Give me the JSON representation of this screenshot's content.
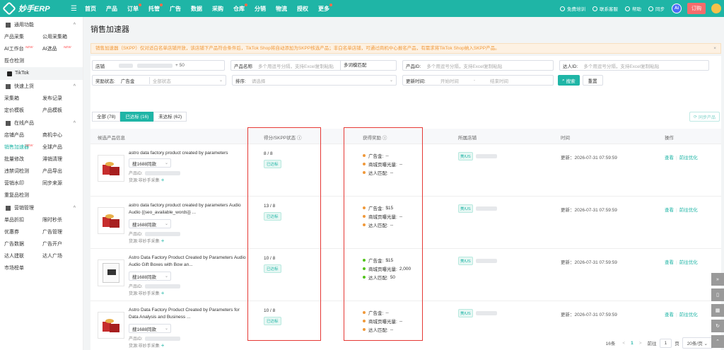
{
  "app": {
    "logo": "妙手ERP"
  },
  "topnav": [
    {
      "label": "首页",
      "dot": false
    },
    {
      "label": "产品",
      "dot": false
    },
    {
      "label": "订单",
      "dot": true
    },
    {
      "label": "托管",
      "dot": true
    },
    {
      "label": "广告",
      "dot": false
    },
    {
      "label": "数据",
      "dot": false
    },
    {
      "label": "采购",
      "dot": false
    },
    {
      "label": "仓库",
      "dot": true
    },
    {
      "label": "分销",
      "dot": false
    },
    {
      "label": "物流",
      "dot": false
    },
    {
      "label": "授权",
      "dot": false
    },
    {
      "label": "更多",
      "dot": true
    }
  ],
  "topright": {
    "training": "免费培训",
    "service": "联系客服",
    "help": "帮助",
    "sync": "同步",
    "ai": "Ai",
    "order": "订购"
  },
  "sidebar": {
    "common_title": "通用功能",
    "common_items": [
      "产品采集",
      "公用采集箱",
      "AI工作台",
      "AI选品"
    ],
    "common_new": [
      false,
      false,
      true,
      true
    ],
    "logistics": "揽仓检测",
    "tiktok": "TikTok",
    "quick_title": "快速上货",
    "quick_items": [
      "采集箱",
      "发布记录",
      "定价模板",
      "产品模板"
    ],
    "online_title": "在线产品",
    "online_items": [
      "店铺产品",
      "商机中心",
      "销售加速器",
      "全球产品",
      "批量修改",
      "滞销清理",
      "违禁词检测",
      "产品导出",
      "营销水印",
      "同步来源"
    ],
    "online_new_index": 2,
    "dup_check": "重复品检测",
    "marketing_title": "营销管理",
    "marketing_items": [
      "单品折扣",
      "限时秒杀",
      "优惠券",
      "广告管理",
      "广告数据",
      "广告开户",
      "达人建联",
      "达人广场"
    ],
    "market_rank": "市场榜单"
  },
  "page": {
    "title": "销售加速器",
    "notice": "销售加速器（SKPP）仅对适白名单店铺开放，该店铺下产品符合条件后，TikTok Shop将自动添加为SKPP核选产品；非白名单店铺，可通过商机中心报名产品，有需求将TikTok Shop纳入SKPP产品。",
    "notice_close": "×"
  },
  "filters": {
    "store_label": "店铺",
    "store_count": "+ 50",
    "product_name_label": "产品名称",
    "product_name_placeholder": "多个用逗号分隔，支持Excel复制粘贴",
    "match_mode": "多词模匹配",
    "product_id_label": "产品ID:",
    "product_id_placeholder": "多个用逗号分隔，支持Excel复制粘贴",
    "talent_id_label": "达人ID:",
    "talent_id_placeholder": "多个用逗号分隔，支持Excel复制粘贴",
    "reward_status_label": "奖励状态:",
    "reward_status_value": "广告金",
    "reward_all": "全部状态",
    "sort_label": "排序:",
    "sort_placeholder": "请选择",
    "update_time_label": "更新时间:",
    "start_time": "开始时间",
    "dash": "-",
    "end_time": "结束时间",
    "search_btn": "搜索",
    "reset_btn": "重置"
  },
  "tabs": [
    "全部 (78)",
    "已达标 (16)",
    "未达标 (62)"
  ],
  "active_tab": 1,
  "sync_btn": "同步产品",
  "table": {
    "headers": [
      "候选产品信息",
      "得分/SKPP状态",
      "获得奖励",
      "所属店铺",
      "时间",
      "操作"
    ],
    "rows": [
      {
        "image": "gift-box",
        "title": "astro data factory product created by parameters",
        "btn": "搜1688同款",
        "id_label": "产品ID:",
        "source_label": "货源:",
        "source": "非妙手采集",
        "score": "8 / 8",
        "status": "已达标",
        "rewards": [
          {
            "label": "广告金:",
            "value": "--",
            "color": "#f0993a"
          },
          {
            "label": "商城页曝光量:",
            "value": "--",
            "color": "#f0993a"
          },
          {
            "label": "达人匹配:",
            "value": "--",
            "color": "#f0993a"
          }
        ],
        "store_region": "美/US",
        "time": "更新：2026-07-31 07:59:59",
        "op_view": "查看",
        "op_optimize": "前往优化"
      },
      {
        "image": "gift-box",
        "title": "astro data factory product created by parameters Audio Audio {{seo_available_words}} ...",
        "btn": "搜1688同款",
        "id_label": "产品ID:",
        "source_label": "货源:",
        "source": "非妙手采集",
        "score": "13 / 8",
        "status": "已达标",
        "rewards": [
          {
            "label": "广告金:",
            "value": "$15",
            "color": "#f0993a"
          },
          {
            "label": "商城页曝光量:",
            "value": "--",
            "color": "#f0993a"
          },
          {
            "label": "达人匹配:",
            "value": "--",
            "color": "#f0993a"
          }
        ],
        "store_region": "美/US",
        "time": "更新：2026-07-31 07:59:59",
        "op_view": "查看",
        "op_optimize": "前往优化"
      },
      {
        "image": "t-shirt",
        "title": "Astro Data Factory Product Created by Parameters Audio Audio Gift Boxes with Bow an...",
        "btn": "搜1688同款",
        "id_label": "产品ID:",
        "source_label": "货源:",
        "source": "非妙手采集",
        "score": "10 / 8",
        "status": "已达标",
        "rewards": [
          {
            "label": "广告金:",
            "value": "$15",
            "color": "#52c41a"
          },
          {
            "label": "商城页曝光量:",
            "value": "2,000",
            "color": "#52c41a"
          },
          {
            "label": "达人匹配:",
            "value": "50",
            "color": "#52c41a"
          }
        ],
        "store_region": "美/US",
        "time": "更新：2026-07-31 07:59:59",
        "op_view": "查看",
        "op_optimize": "前往优化"
      },
      {
        "image": "gift-box",
        "title": "Astro Data Factory Product Created by Parameters for Data Analysis and Business ...",
        "btn": "搜1688同款",
        "id_label": "产品ID:",
        "source_label": "货源:",
        "source": "非妙手采集",
        "score": "10 / 8",
        "status": "已达标",
        "rewards": [
          {
            "label": "广告金:",
            "value": "--",
            "color": "#f0993a"
          },
          {
            "label": "商城页曝光量:",
            "value": "--",
            "color": "#f0993a"
          },
          {
            "label": "达人匹配:",
            "value": "--",
            "color": "#f0993a"
          }
        ],
        "store_region": "美/US",
        "time": "更新：2026-07-31 07:59:59",
        "op_view": "查看",
        "op_optimize": "前往优化"
      }
    ]
  },
  "pagination": {
    "total": "16条",
    "prev": "<",
    "page": "1",
    "next": ">",
    "goto": "前往",
    "goto_value": "1",
    "page_unit": "页",
    "page_size": "20条/页"
  },
  "colors": {
    "brand": "#1fb5a6",
    "highlight_box": "#e53935"
  }
}
